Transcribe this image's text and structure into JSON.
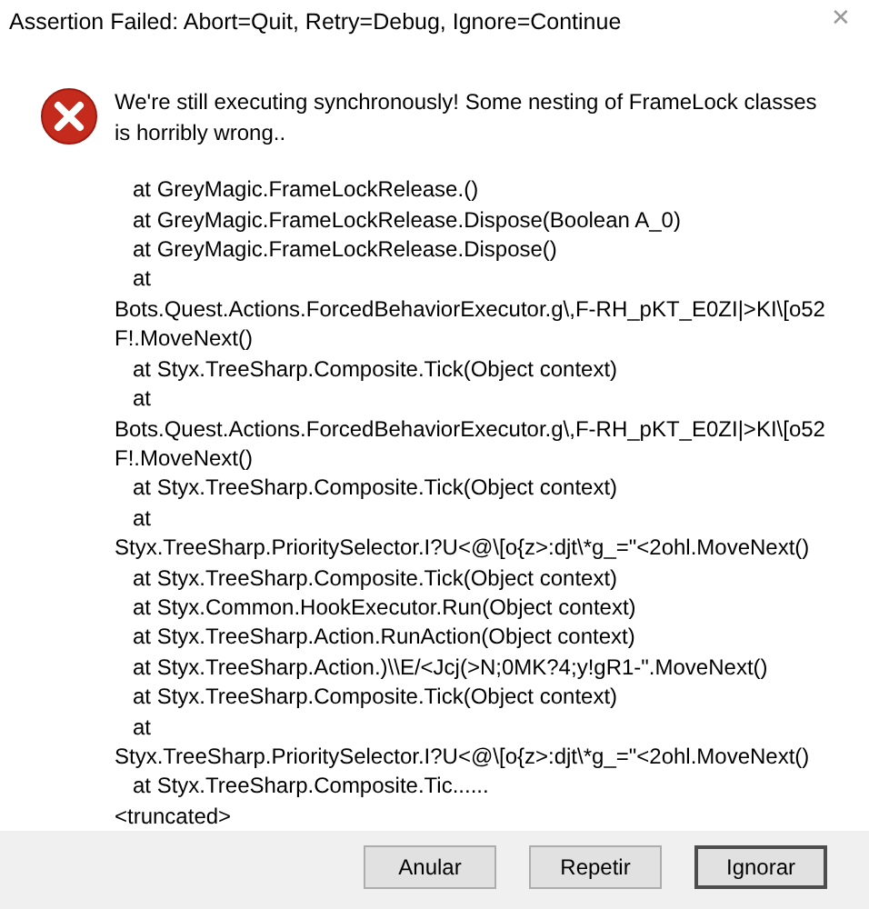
{
  "window": {
    "title": "Assertion Failed: Abort=Quit, Retry=Debug, Ignore=Continue",
    "close": "✕"
  },
  "message": {
    "lines": [
      "We're still executing synchronously! Some nesting of FrameLock classes",
      "is horribly wrong.."
    ]
  },
  "stack_trace": [
    {
      "kind": "frame",
      "text": "at GreyMagic.FrameLockRelease.()"
    },
    {
      "kind": "frame",
      "text": "at GreyMagic.FrameLockRelease.Dispose(Boolean A_0)"
    },
    {
      "kind": "frame",
      "text": "at GreyMagic.FrameLockRelease.Dispose()"
    },
    {
      "kind": "frame",
      "text": "at"
    },
    {
      "kind": "wrap",
      "text": "Bots.Quest.Actions.ForcedBehaviorExecutor.g\\,F-RH_pKT_E0ZI|>KI\\[o52"
    },
    {
      "kind": "wrap",
      "text": "F!.MoveNext()"
    },
    {
      "kind": "frame",
      "text": "at Styx.TreeSharp.Composite.Tick(Object context)"
    },
    {
      "kind": "frame",
      "text": "at"
    },
    {
      "kind": "wrap",
      "text": "Bots.Quest.Actions.ForcedBehaviorExecutor.g\\,F-RH_pKT_E0ZI|>KI\\[o52"
    },
    {
      "kind": "wrap",
      "text": "F!.MoveNext()"
    },
    {
      "kind": "frame",
      "text": "at Styx.TreeSharp.Composite.Tick(Object context)"
    },
    {
      "kind": "frame",
      "text": "at"
    },
    {
      "kind": "wrap",
      "text": "Styx.TreeSharp.PrioritySelector.I?U<@\\[o{z>:djt\\*g_=\"<2ohl.MoveNext()"
    },
    {
      "kind": "frame",
      "text": "at Styx.TreeSharp.Composite.Tick(Object context)"
    },
    {
      "kind": "frame",
      "text": "at Styx.Common.HookExecutor.Run(Object context)"
    },
    {
      "kind": "frame",
      "text": "at Styx.TreeSharp.Action.RunAction(Object context)"
    },
    {
      "kind": "frame",
      "text": "at Styx.TreeSharp.Action.)\\\\E/<Jcj(>N;0MK?4;y!gR1-\".MoveNext()"
    },
    {
      "kind": "frame",
      "text": "at Styx.TreeSharp.Composite.Tick(Object context)"
    },
    {
      "kind": "frame",
      "text": "at"
    },
    {
      "kind": "wrap",
      "text": "Styx.TreeSharp.PrioritySelector.I?U<@\\[o{z>:djt\\*g_=\"<2ohl.MoveNext()"
    },
    {
      "kind": "frame",
      "text": "at Styx.TreeSharp.Composite.Tic......"
    },
    {
      "kind": "wrap",
      "text": "<truncated>"
    }
  ],
  "buttons": [
    {
      "label": "Anular",
      "default": false
    },
    {
      "label": "Repetir",
      "default": false
    },
    {
      "label": "Ignorar",
      "default": true
    }
  ]
}
